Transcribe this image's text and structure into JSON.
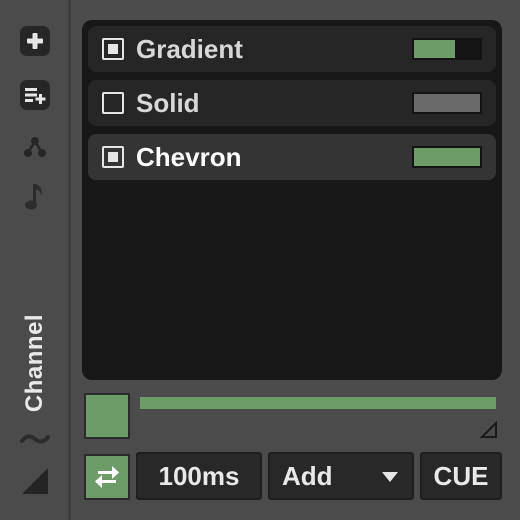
{
  "sidebar": {
    "label": "Channel",
    "tools": [
      {
        "icon": "plus-icon"
      },
      {
        "icon": "add-to-list-icon"
      },
      {
        "icon": "network-icon"
      },
      {
        "icon": "music-note-icon"
      },
      {
        "icon": "wave-icon"
      },
      {
        "icon": "corner-triangle-icon"
      }
    ]
  },
  "patterns": [
    {
      "label": "Gradient",
      "checked": "partial",
      "color": "#6e9c68",
      "level": 0.62
    },
    {
      "label": "Solid",
      "checked": "off",
      "color": "#6a6a6a",
      "level": 1.0
    },
    {
      "label": "Chevron",
      "checked": "partial",
      "color": "#6e9c68",
      "level": 1.0,
      "active": true
    }
  ],
  "controls": {
    "color": "#6e9c68",
    "fader_level": 1.0,
    "duration": "100ms",
    "blend_mode": "Add",
    "cue_label": "CUE",
    "swap_icon": "swap-arrows-icon"
  },
  "colors": {
    "accent": "#6e9c68",
    "panel": "#4b4b4b",
    "list_bg": "#171717"
  }
}
